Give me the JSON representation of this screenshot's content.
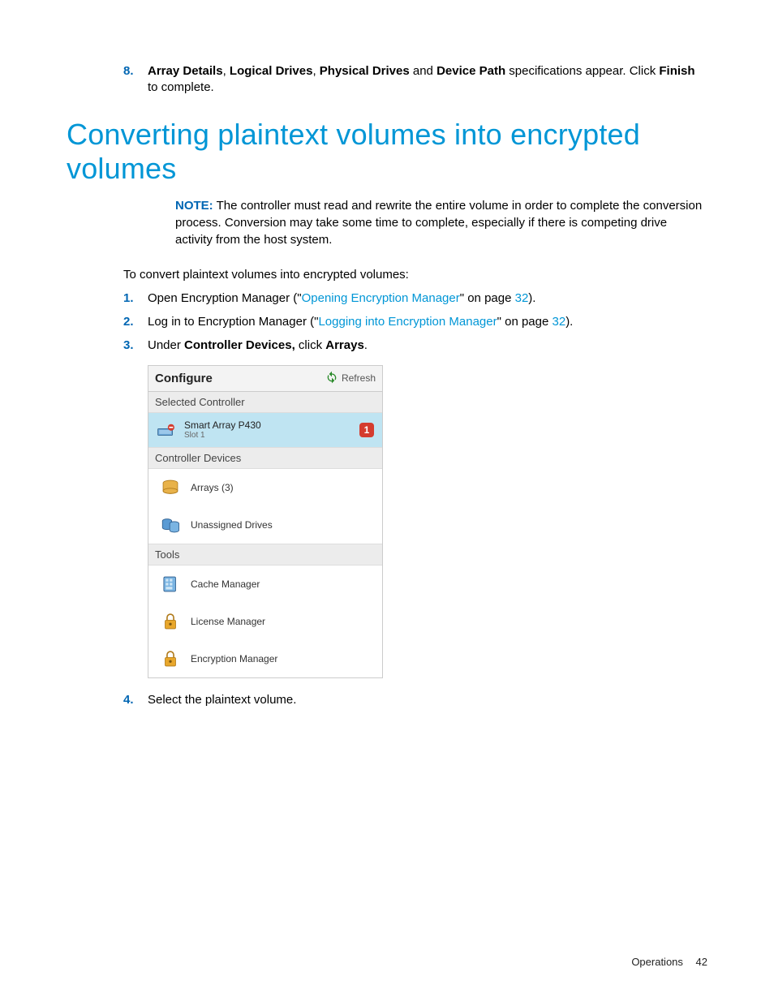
{
  "list8": {
    "num": "8.",
    "parts": [
      "Array Details",
      ", ",
      "Logical Drives",
      ", ",
      "Physical Drives",
      " and ",
      "Device Path",
      " specifications appear. Click ",
      "Finish",
      " to complete."
    ]
  },
  "heading": "Converting plaintext volumes into encrypted volumes",
  "note": {
    "label": "NOTE:",
    "text": "  The controller must read and rewrite the entire volume in order to complete the conversion process. Conversion may take some time to complete, especially if there is competing drive activity from the host system."
  },
  "intro": "To convert plaintext volumes into encrypted volumes:",
  "steps": {
    "s1": {
      "num": "1.",
      "pre": "Open Encryption Manager (\"",
      "link": "Opening Encryption Manager",
      "post": "\" on page ",
      "page": "32",
      "end": ")."
    },
    "s2": {
      "num": "2.",
      "pre": "Log in to Encryption Manager (\"",
      "link": "Logging into Encryption Manager",
      "post": "\" on page ",
      "page": "32",
      "end": ")."
    },
    "s3": {
      "num": "3.",
      "pre": "Under ",
      "b1": "Controller Devices,",
      "mid": " click ",
      "b2": "Arrays",
      "end": "."
    },
    "s4": {
      "num": "4.",
      "text": "Select the plaintext volume."
    }
  },
  "panel": {
    "title": "Configure",
    "refresh": "Refresh",
    "sec_selected": "Selected Controller",
    "controller": {
      "name": "Smart Array P430",
      "slot": "Slot 1",
      "badge": "1"
    },
    "sec_devices": "Controller Devices",
    "arrays": "Arrays (3)",
    "unassigned": "Unassigned Drives",
    "sec_tools": "Tools",
    "cache": "Cache Manager",
    "license": "License Manager",
    "encryption": "Encryption Manager"
  },
  "footer": {
    "section": "Operations",
    "page": "42"
  }
}
